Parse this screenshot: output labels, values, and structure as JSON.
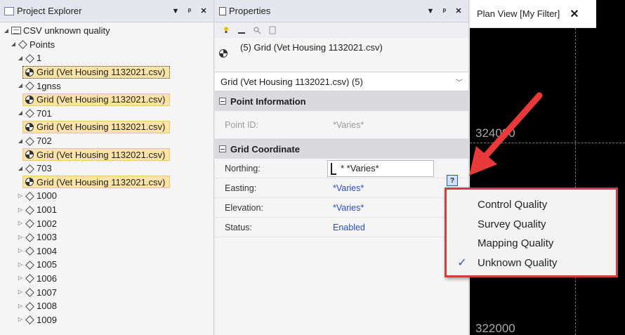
{
  "explorer": {
    "title": "Project Explorer",
    "root": "CSV unknown quality",
    "points_label": "Points",
    "rows": [
      {
        "type": "point",
        "label": "1",
        "expanded": true
      },
      {
        "type": "grid",
        "label": "Grid (Vet Housing 1132021.csv)",
        "selected": true
      },
      {
        "type": "point",
        "label": "1gnss",
        "expanded": true
      },
      {
        "type": "grid",
        "label": "Grid (Vet Housing 1132021.csv)"
      },
      {
        "type": "point",
        "label": "701",
        "expanded": true
      },
      {
        "type": "grid",
        "label": "Grid (Vet Housing 1132021.csv)"
      },
      {
        "type": "point",
        "label": "702",
        "expanded": true
      },
      {
        "type": "grid",
        "label": "Grid (Vet Housing 1132021.csv)"
      },
      {
        "type": "point",
        "label": "703",
        "expanded": true
      },
      {
        "type": "grid",
        "label": "Grid (Vet Housing 1132021.csv)"
      },
      {
        "type": "point",
        "label": "1000"
      },
      {
        "type": "point",
        "label": "1001"
      },
      {
        "type": "point",
        "label": "1002"
      },
      {
        "type": "point",
        "label": "1003"
      },
      {
        "type": "point",
        "label": "1004"
      },
      {
        "type": "point",
        "label": "1005"
      },
      {
        "type": "point",
        "label": "1006"
      },
      {
        "type": "point",
        "label": "1007"
      },
      {
        "type": "point",
        "label": "1008"
      },
      {
        "type": "point",
        "label": "1009"
      }
    ]
  },
  "properties": {
    "title": "Properties",
    "object_label": "(5) Grid (Vet Housing 1132021.csv)",
    "selector_value": "Grid (Vet Housing 1132021.csv) (5)",
    "section_point": "Point Information",
    "point_id_label": "Point ID:",
    "point_id_value": "*Varies*",
    "section_grid": "Grid Coordinate",
    "northing_label": "Northing:",
    "northing_value": "* *Varies*",
    "easting_label": "Easting:",
    "easting_value": "*Varies*",
    "elevation_label": "Elevation:",
    "elevation_value": "*Varies*",
    "status_label": "Status:",
    "status_value": "Enabled",
    "quality_button": "?"
  },
  "planview": {
    "tab_title": "Plan View [My Filter]",
    "coord_top": "324000",
    "coord_bottom": "322000"
  },
  "quality_menu": {
    "items": [
      {
        "label": "Control Quality",
        "checked": false
      },
      {
        "label": "Survey Quality",
        "checked": false
      },
      {
        "label": "Mapping Quality",
        "checked": false
      },
      {
        "label": "Unknown Quality",
        "checked": true
      }
    ],
    "check_glyph": "✓",
    "highlight_color": "#d83b3b"
  }
}
